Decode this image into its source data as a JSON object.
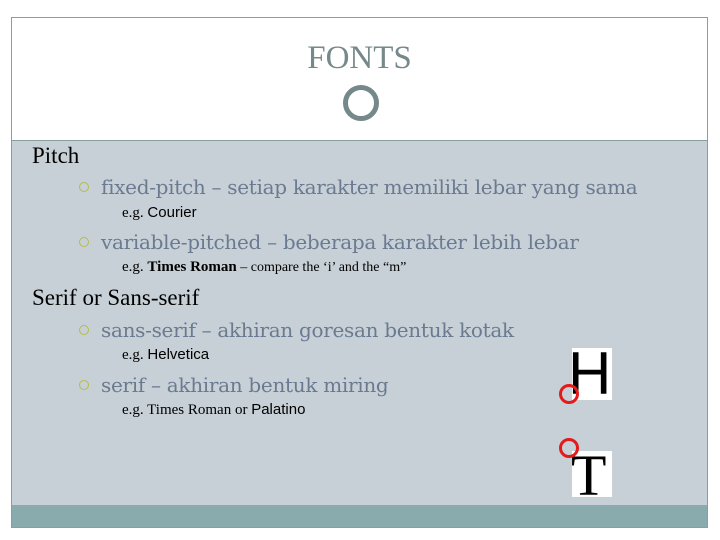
{
  "slide": {
    "title": "FONTS",
    "sections": [
      {
        "heading": "Pitch",
        "bullets": [
          {
            "text": "fixed-pitch – setiap karakter memiliki lebar yang sama",
            "example_prefix": "e.g.",
            "example": "Courier",
            "example_suffix": ""
          },
          {
            "text": "variable-pitched  – beberapa karakter lebih lebar",
            "example_prefix": "e.g.",
            "example": "Times Roman",
            "example_suffix": " – compare the ‘i’ and the “m”"
          }
        ]
      },
      {
        "heading": "Serif or Sans-serif",
        "bullets": [
          {
            "text": "sans-serif – akhiran goresan bentuk kotak",
            "example_prefix": "e.g.",
            "example": "Helvetica",
            "example_suffix": ""
          },
          {
            "text": "serif  –  akhiran bentuk miring",
            "example_prefix": "e.g.",
            "example": "Times Roman",
            "example_join": " or ",
            "example2": "Palatino"
          }
        ]
      }
    ],
    "illustration": {
      "letters": [
        "H",
        "T"
      ],
      "highlight_color": "#e31b1b"
    }
  },
  "theme": {
    "title_color": "#75888a",
    "content_bg": "#c6d0d6",
    "footer_bg": "#8aabad",
    "bullet_color": "#6b7a90",
    "bullet_marker": "#b8ba4a"
  }
}
